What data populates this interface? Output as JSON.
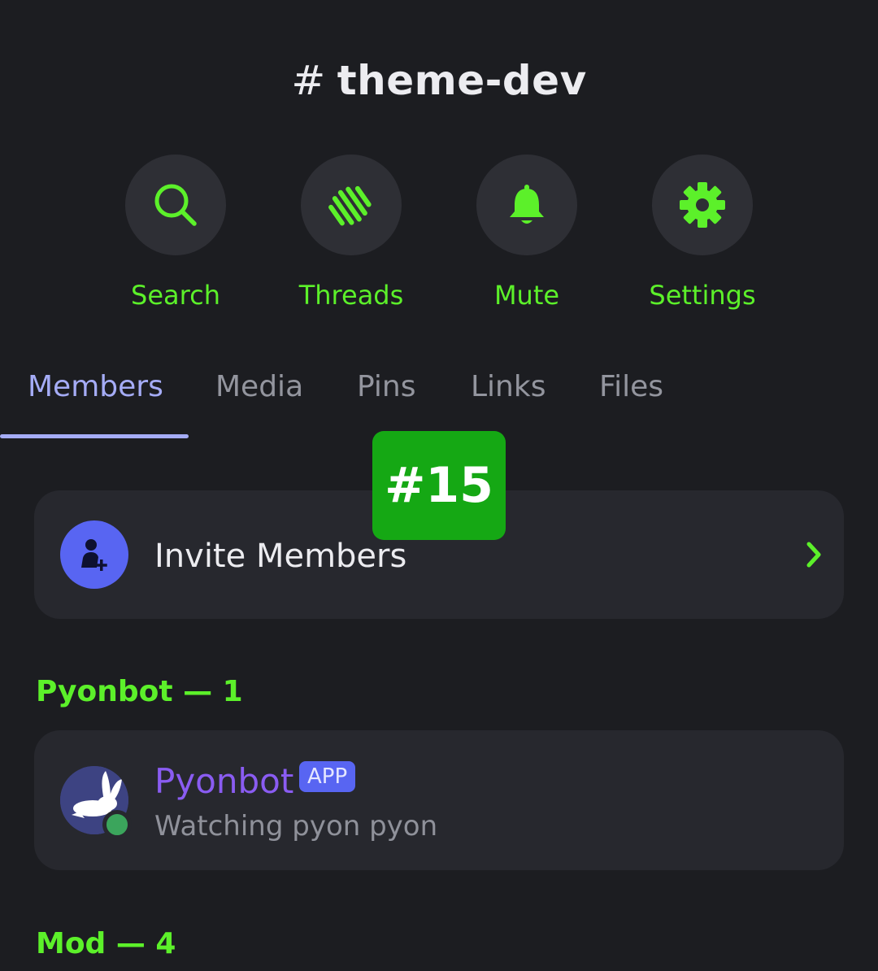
{
  "header": {
    "hash": "#",
    "channel_name": "theme-dev"
  },
  "actions": [
    {
      "label": "Search",
      "icon": "search-icon"
    },
    {
      "label": "Threads",
      "icon": "threads-icon"
    },
    {
      "label": "Mute",
      "icon": "bell-icon"
    },
    {
      "label": "Settings",
      "icon": "gear-icon"
    }
  ],
  "tabs": [
    {
      "label": "Members",
      "active": true
    },
    {
      "label": "Media",
      "active": false
    },
    {
      "label": "Pins",
      "active": false
    },
    {
      "label": "Links",
      "active": false
    },
    {
      "label": "Files",
      "active": false
    }
  ],
  "invite": {
    "label": "Invite Members",
    "icon": "add-user-icon"
  },
  "overlay_badge": "#15",
  "sections": [
    {
      "header": "Pyonbot — 1",
      "members": [
        {
          "name": "Pyonbot",
          "badge": "APP",
          "status_text": "Watching pyon pyon",
          "presence": "online"
        }
      ]
    },
    {
      "header": "Mod — 4",
      "members": []
    }
  ],
  "colors": {
    "background": "#1c1d21",
    "accent_green": "#5cf02a",
    "tab_active": "#a5acf6",
    "blurple": "#5865f2",
    "bot_name": "#8a5cf2",
    "online": "#3ba55c",
    "badge_green": "#15a814"
  }
}
